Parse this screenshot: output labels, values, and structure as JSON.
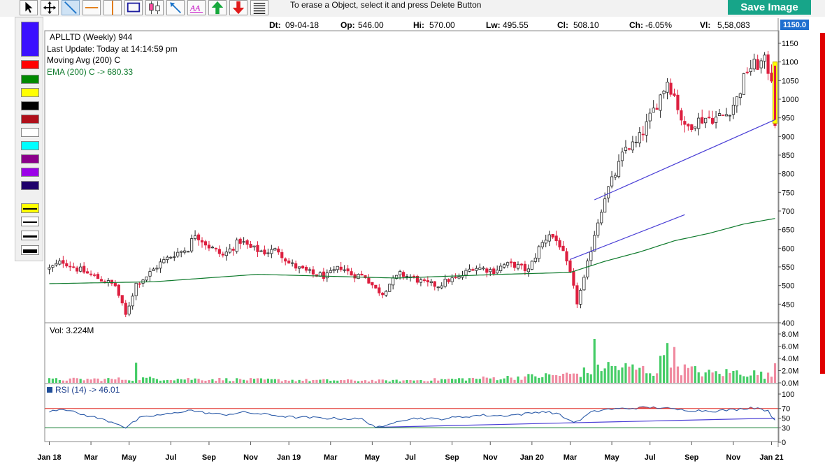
{
  "toolbar": {
    "tools": [
      {
        "name": "pointer-tool",
        "icon": "arrow-cursor-icon"
      },
      {
        "name": "move-tool",
        "icon": "move-arrows-icon"
      },
      {
        "name": "trendline-tool",
        "icon": "diagonal-line-icon"
      },
      {
        "name": "horizontal-line-tool",
        "icon": "horizontal-line-icon"
      },
      {
        "name": "vertical-line-tool",
        "icon": "vertical-line-icon"
      },
      {
        "name": "rectangle-tool",
        "icon": "rectangle-icon"
      },
      {
        "name": "candle-tool",
        "icon": "candle-icon"
      },
      {
        "name": "arrow-line-tool",
        "icon": "arrow-line-icon"
      },
      {
        "name": "text-tool",
        "icon": "text-aa-icon"
      },
      {
        "name": "up-arrow-tool",
        "icon": "green-up-arrow-icon"
      },
      {
        "name": "down-arrow-tool",
        "icon": "red-down-arrow-icon"
      },
      {
        "name": "lines-tool",
        "icon": "horizontal-lines-icon"
      }
    ],
    "hint": "To erase a Object, select it and press Delete Button",
    "save_label": "Save Image"
  },
  "palette": {
    "colors": [
      "#3b10ff",
      "#ff0000",
      "#008a00",
      "#ffff00",
      "#000000",
      "#b00f1a",
      "#ffffff",
      "#00ffff",
      "#8b008b",
      "#9b00e8",
      "#1f006b"
    ],
    "line_styles": [
      "thin-yellow",
      "thin-black",
      "medium-black",
      "thick-black"
    ]
  },
  "ohlc": {
    "dt_label": "Dt:",
    "dt": "09-04-18",
    "op_label": "Op:",
    "op": "546.00",
    "hi_label": "Hi:",
    "hi": "570.00",
    "lw_label": "Lw:",
    "lw": "495.55",
    "cl_label": "Cl:",
    "cl": "508.10",
    "ch_label": "Ch:",
    "ch": "-6.05%",
    "vl_label": "Vl:",
    "vl": "5,58,083"
  },
  "price_tag": "1150.0",
  "info": {
    "symbol": "APLLTD (Weekly) 944",
    "last_update": "Last Update: Today at 14:14:59 pm",
    "moving_avg": "Moving Avg (200) C",
    "ema": "EMA (200) C -> 680.33"
  },
  "vol_label": "Vol: 3.224M",
  "rsi_label": "RSI (14) -> 46.01",
  "colors": {
    "up": "#44cc66",
    "down": "#dd1f3f",
    "ema": "#0e7a2c",
    "trendline": "#4a3fd6",
    "rsi": "#2a5aa8"
  },
  "chart_data": {
    "type": "candlestick",
    "price_axis": {
      "ticks": [
        400,
        450,
        500,
        550,
        600,
        650,
        700,
        750,
        800,
        850,
        900,
        950,
        1000,
        1050,
        1100,
        1150
      ],
      "ylim": [
        400,
        1150
      ]
    },
    "volume_axis": {
      "ticks": [
        "0.0M",
        "2.0M",
        "4.0M",
        "6.0M",
        "8.0M"
      ],
      "ylim": [
        0,
        8
      ]
    },
    "rsi_axis": {
      "ticks": [
        0,
        30,
        50,
        70,
        100
      ],
      "ylim": [
        0,
        100
      ],
      "overbought": 70,
      "oversold": 30
    },
    "x_labels": [
      "Jan 18",
      "Mar",
      "May",
      "Jul",
      "Sep",
      "Nov",
      "Jan 19",
      "Mar",
      "May",
      "Jul",
      "Sep",
      "Nov",
      "Jan 20",
      "Mar",
      "May",
      "Jul",
      "Sep",
      "Nov",
      "Jan 21"
    ],
    "anchors": [
      [
        0,
        545
      ],
      [
        4,
        565
      ],
      [
        8,
        545
      ],
      [
        14,
        520
      ],
      [
        19,
        500
      ],
      [
        22,
        420
      ],
      [
        25,
        505
      ],
      [
        28,
        525
      ],
      [
        32,
        560
      ],
      [
        36,
        585
      ],
      [
        40,
        600
      ],
      [
        42,
        640
      ],
      [
        46,
        605
      ],
      [
        50,
        580
      ],
      [
        55,
        620
      ],
      [
        58,
        600
      ],
      [
        62,
        590
      ],
      [
        66,
        595
      ],
      [
        69,
        560
      ],
      [
        72,
        545
      ],
      [
        76,
        530
      ],
      [
        80,
        525
      ],
      [
        84,
        550
      ],
      [
        87,
        530
      ],
      [
        91,
        525
      ],
      [
        94,
        490
      ],
      [
        96,
        480
      ],
      [
        98,
        505
      ],
      [
        101,
        530
      ],
      [
        105,
        520
      ],
      [
        108,
        505
      ],
      [
        112,
        500
      ],
      [
        115,
        515
      ],
      [
        118,
        520
      ],
      [
        122,
        550
      ],
      [
        125,
        545
      ],
      [
        128,
        540
      ],
      [
        131,
        555
      ],
      [
        134,
        555
      ],
      [
        138,
        540
      ],
      [
        141,
        600
      ],
      [
        144,
        640
      ],
      [
        147,
        610
      ],
      [
        150,
        530
      ],
      [
        152,
        455
      ],
      [
        154,
        515
      ],
      [
        157,
        640
      ],
      [
        160,
        740
      ],
      [
        163,
        800
      ],
      [
        166,
        870
      ],
      [
        169,
        880
      ],
      [
        172,
        930
      ],
      [
        175,
        990
      ],
      [
        178,
        1050
      ],
      [
        180,
        1010
      ],
      [
        183,
        920
      ],
      [
        186,
        940
      ],
      [
        189,
        950
      ],
      [
        192,
        950
      ],
      [
        195,
        960
      ],
      [
        198,
        1000
      ],
      [
        201,
        1080
      ],
      [
        203,
        1090
      ],
      [
        206,
        1100
      ],
      [
        208,
        1060
      ],
      [
        209,
        940
      ]
    ],
    "ema_anchors": [
      [
        0,
        505
      ],
      [
        30,
        510
      ],
      [
        60,
        530
      ],
      [
        100,
        520
      ],
      [
        130,
        530
      ],
      [
        150,
        535
      ],
      [
        160,
        565
      ],
      [
        170,
        590
      ],
      [
        180,
        620
      ],
      [
        190,
        640
      ],
      [
        200,
        665
      ],
      [
        209,
        680
      ]
    ],
    "volume_anchors": [
      [
        0,
        0.6
      ],
      [
        24,
        0.7
      ],
      [
        25,
        3.3
      ],
      [
        26,
        0.8
      ],
      [
        70,
        0.5
      ],
      [
        100,
        0.4
      ],
      [
        130,
        0.9
      ],
      [
        150,
        1.5
      ],
      [
        156,
        2.2
      ],
      [
        157,
        7.2
      ],
      [
        158,
        3.1
      ],
      [
        170,
        2.5
      ],
      [
        175,
        2.0
      ],
      [
        178,
        6.5
      ],
      [
        182,
        2.6
      ],
      [
        190,
        1.7
      ],
      [
        200,
        2.0
      ],
      [
        208,
        1.2
      ],
      [
        209,
        3.2
      ]
    ],
    "rsi_anchors": [
      [
        0,
        65
      ],
      [
        4,
        70
      ],
      [
        8,
        60
      ],
      [
        14,
        50
      ],
      [
        20,
        38
      ],
      [
        22,
        30
      ],
      [
        26,
        50
      ],
      [
        30,
        55
      ],
      [
        36,
        60
      ],
      [
        40,
        67
      ],
      [
        44,
        62
      ],
      [
        50,
        57
      ],
      [
        56,
        62
      ],
      [
        62,
        58
      ],
      [
        70,
        52
      ],
      [
        80,
        50
      ],
      [
        90,
        48
      ],
      [
        94,
        32
      ],
      [
        96,
        30
      ],
      [
        100,
        45
      ],
      [
        106,
        50
      ],
      [
        112,
        48
      ],
      [
        118,
        52
      ],
      [
        124,
        56
      ],
      [
        130,
        55
      ],
      [
        136,
        58
      ],
      [
        142,
        64
      ],
      [
        146,
        60
      ],
      [
        150,
        45
      ],
      [
        152,
        42
      ],
      [
        156,
        62
      ],
      [
        160,
        68
      ],
      [
        166,
        70
      ],
      [
        172,
        72
      ],
      [
        176,
        72
      ],
      [
        180,
        68
      ],
      [
        186,
        66
      ],
      [
        192,
        65
      ],
      [
        198,
        68
      ],
      [
        202,
        72
      ],
      [
        205,
        70
      ],
      [
        207,
        64
      ],
      [
        209,
        46
      ]
    ],
    "trendlines": [
      {
        "from": [
          150,
          570
        ],
        "to": [
          183,
          690
        ]
      },
      {
        "from": [
          157,
          730
        ],
        "to": [
          209,
          945
        ]
      },
      {
        "from": [
          94,
          31
        ],
        "to": [
          209,
          50
        ],
        "panel": "rsi"
      }
    ]
  }
}
